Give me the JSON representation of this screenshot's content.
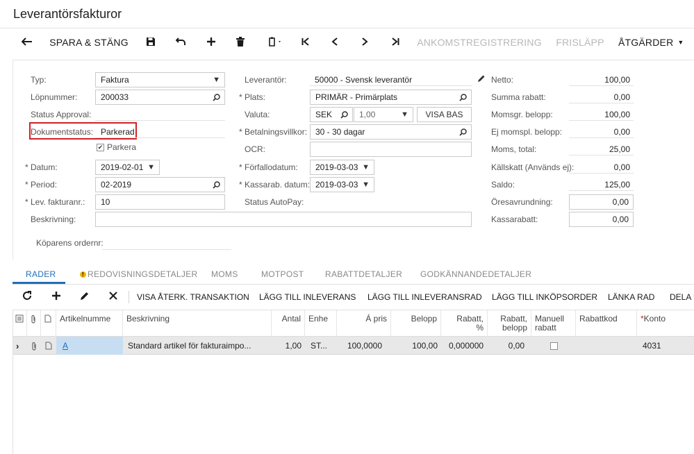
{
  "page": {
    "title": "Leverantörsfakturor"
  },
  "toolbar": {
    "back_icon": "arrow-left-icon",
    "save_close": "SPARA & STÄNG",
    "save_icon": "floppy-disk-icon",
    "undo_icon": "undo-icon",
    "add_icon": "plus-icon",
    "delete_icon": "trash-icon",
    "copy_icon": "clipboard-copy-icon",
    "first_icon": "first-record-icon",
    "prev_icon": "chevron-left-icon",
    "next_icon": "chevron-right-icon",
    "last_icon": "last-record-icon",
    "receipt": "ANKOMSTREGISTRERING",
    "release": "FRISLÄPP",
    "actions": "ÅTGÄRDER"
  },
  "form": {
    "typ": {
      "label": "Typ:",
      "value": "Faktura"
    },
    "lopnummer": {
      "label": "Löpnummer:",
      "value": "200033"
    },
    "status_approval": {
      "label": "Status Approval:",
      "value": ""
    },
    "dokumentstatus": {
      "label": "Dokumentstatus:",
      "value": "Parkerad"
    },
    "parkera": {
      "label": "Parkera",
      "checked": true
    },
    "datum": {
      "label": "Datum:",
      "value": "2019-02-01"
    },
    "period": {
      "label": "Period:",
      "value": "02-2019"
    },
    "lev_fakturanr": {
      "label": "Lev. fakturanr.:",
      "value": "10"
    },
    "beskrivning": {
      "label": "Beskrivning:",
      "value": ""
    },
    "koparens_ordernr": {
      "label": "Köparens ordernr:",
      "value": ""
    },
    "leverantor": {
      "label": "Leverantör:",
      "value": "50000 - Svensk leverantör"
    },
    "plats": {
      "label": "Plats:",
      "value": "PRIMÄR - Primärplats"
    },
    "valuta": {
      "label": "Valuta:",
      "currency": "SEK",
      "rate": "1,00",
      "button": "VISA BAS"
    },
    "betalningsvillkor": {
      "label": "Betalningsvillkor:",
      "value": "30 - 30 dagar"
    },
    "ocr": {
      "label": "OCR:",
      "value": ""
    },
    "forfallodatum": {
      "label": "Förfallodatum:",
      "value": "2019-03-03"
    },
    "kassarab_datum": {
      "label": "Kassarab. datum:",
      "value": "2019-03-03"
    },
    "status_autopay": {
      "label": "Status AutoPay:",
      "value": ""
    }
  },
  "totals": {
    "netto": {
      "label": "Netto:",
      "value": "100,00"
    },
    "summa_rabatt": {
      "label": "Summa rabatt:",
      "value": "0,00"
    },
    "momsgr_belopp": {
      "label": "Momsgr. belopp:",
      "value": "100,00"
    },
    "ej_momspl_belopp": {
      "label": "Ej momspl. belopp:",
      "value": "0,00"
    },
    "moms_total": {
      "label": "Moms, total:",
      "value": "25,00"
    },
    "kallskatt": {
      "label": "Källskatt (Används ej):",
      "value": "0,00"
    },
    "saldo": {
      "label": "Saldo:",
      "value": "125,00"
    },
    "oresavrundning": {
      "label": "Öresavrundning:",
      "value": "0,00"
    },
    "kassarabatt": {
      "label": "Kassarabatt:",
      "value": "0,00"
    }
  },
  "tabs": [
    {
      "label": "RADER"
    },
    {
      "label": "REDOVISNINGSDETALJER"
    },
    {
      "label": "MOMS"
    },
    {
      "label": "MOTPOST"
    },
    {
      "label": "RABATTDETALJER"
    },
    {
      "label": "GODKÄNNANDEDETALJER"
    }
  ],
  "gridbar": {
    "refresh_icon": "refresh-icon",
    "add_icon": "plus-icon",
    "edit_icon": "pencil-icon",
    "delete_icon": "close-icon",
    "view_transaction": "VISA ÅTERK. TRANSAKTION",
    "add_receipt": "LÄGG TILL INLEVERANS",
    "add_receipt_line": "LÄGG TILL INLEVERANSRAD",
    "add_po": "LÄGG TILL INKÖPSORDER",
    "link_line": "LÄNKA RAD",
    "split": "DELA U"
  },
  "grid": {
    "columns": {
      "artikelnummer": "Artikelnumme",
      "beskrivning": "Beskrivning",
      "antal": "Antal",
      "enhet": "Enhe",
      "a_pris": "Á pris",
      "belopp": "Belopp",
      "rabatt_pct": "Rabatt,\n%",
      "rabatt_belopp": "Rabatt,\nbelopp",
      "manuell_rabatt": "Manuell\nrabatt",
      "rabattkod": "Rabattkod",
      "konto": "Konto"
    },
    "rows": [
      {
        "artikelnummer": "A",
        "beskrivning": "Standard artikel för fakturaimpo...",
        "antal": "1,00",
        "enhet": "ST...",
        "a_pris": "100,0000",
        "belopp": "100,00",
        "rabatt_pct": "0,000000",
        "rabatt_belopp": "0,00",
        "manuell_rabatt": false,
        "rabattkod": "",
        "konto": "4031"
      }
    ]
  }
}
